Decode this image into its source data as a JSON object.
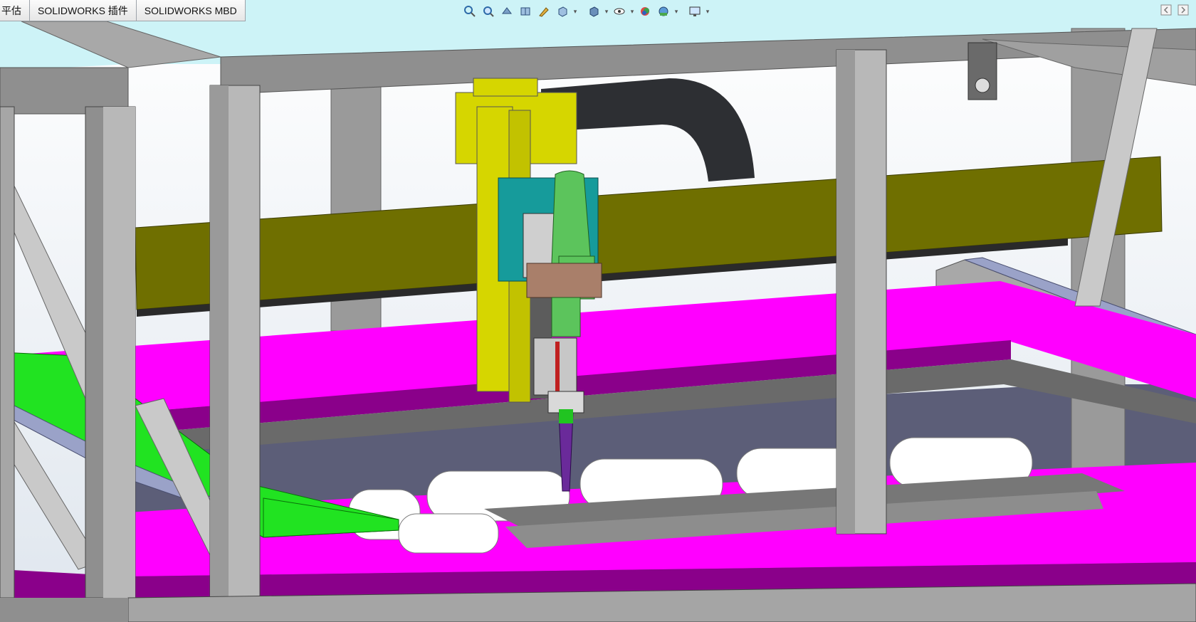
{
  "tabs": [
    {
      "label": "平估"
    },
    {
      "label": "SOLIDWORKS 插件"
    },
    {
      "label": "SOLIDWORKS MBD"
    }
  ],
  "heads_up_toolbar": [
    {
      "icon": "zoom-to-fit-icon"
    },
    {
      "icon": "zoom-to-area-icon"
    },
    {
      "icon": "previous-view-icon"
    },
    {
      "icon": "section-view-icon"
    },
    {
      "icon": "dynamic-annotation-icon"
    },
    {
      "icon": "view-orientation-icon"
    },
    {
      "icon": "display-style-icon"
    },
    {
      "icon": "hide-show-items-icon"
    },
    {
      "icon": "edit-appearance-icon"
    },
    {
      "icon": "apply-scene-icon"
    },
    {
      "icon": "view-settings-icon"
    }
  ],
  "task_pane_toggles": [
    {
      "icon": "collapse-left-icon"
    },
    {
      "icon": "expand-right-icon"
    }
  ],
  "colors": {
    "frame_steel": "#8f8f8f",
    "gantry_beam": "#6f6f00",
    "work_table": "#ff00ff",
    "table_edge": "#8a008a",
    "green_plate": "#21e321",
    "actuator_yellow": "#d6d600",
    "mount_teal": "#169b9b",
    "tool_green": "#5cc45c",
    "bronze_block": "#a97f6a",
    "top_glass": "#cdf3f7",
    "cable_carrier": "#2d2f33",
    "rail_blue": "#9aa2c8",
    "background": "#dfe6ee"
  }
}
